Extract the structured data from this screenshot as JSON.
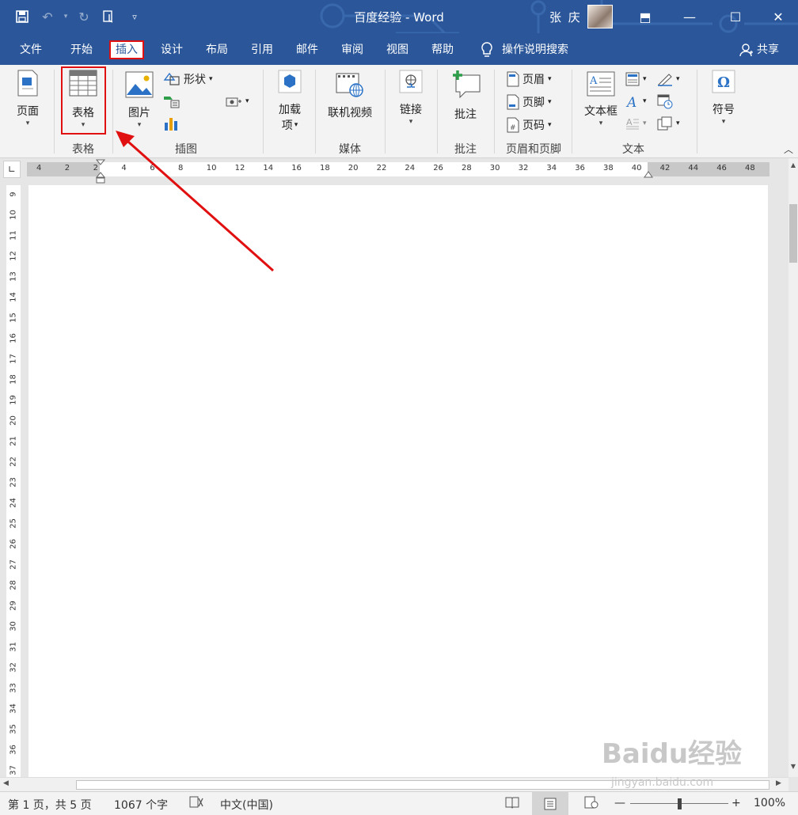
{
  "app": {
    "title": "百度经验  -  Word",
    "user_name": "张 庆"
  },
  "qat": {
    "save_icon": "save-icon",
    "undo_icon": "undo-icon",
    "redo_icon": "redo-icon",
    "touch_icon": "touch-mode-icon",
    "customize_icon": "customize-qat-icon"
  },
  "window_buttons": {
    "ribbon_display": "⬒",
    "minimize": "—",
    "maximize": "☐",
    "close": "✕"
  },
  "tabs": [
    {
      "label": "文件"
    },
    {
      "label": "开始"
    },
    {
      "label": "插入"
    },
    {
      "label": "设计"
    },
    {
      "label": "布局"
    },
    {
      "label": "引用"
    },
    {
      "label": "邮件"
    },
    {
      "label": "审阅"
    },
    {
      "label": "视图"
    },
    {
      "label": "帮助"
    }
  ],
  "tell_me": "操作说明搜索",
  "share": "共享",
  "ribbon": {
    "pages": {
      "label": "页面"
    },
    "table": {
      "label": "表格",
      "group": "表格"
    },
    "picture": {
      "label": "图片"
    },
    "shapes": {
      "label": "形状"
    },
    "illustrations_group": "插图",
    "addins": {
      "label1": "加载",
      "label2": "项"
    },
    "online_video": {
      "label": "联机视频"
    },
    "media_group": "媒体",
    "link": {
      "label": "链接"
    },
    "comment": {
      "label": "批注",
      "group": "批注"
    },
    "header": {
      "label": "页眉"
    },
    "footer": {
      "label": "页脚"
    },
    "page_number": {
      "label": "页码"
    },
    "header_footer_group": "页眉和页脚",
    "textbox": {
      "label": "文本框"
    },
    "text_group": "文本",
    "symbol": {
      "label": "符号"
    }
  },
  "ruler": {
    "h_labels": [
      "4",
      "2",
      "2",
      "4",
      "6",
      "8",
      "10",
      "12",
      "14",
      "16",
      "18",
      "20",
      "22",
      "24",
      "26",
      "28",
      "30",
      "32",
      "34",
      "36",
      "38",
      "40",
      "42",
      "44",
      "46",
      "48"
    ],
    "v_labels": [
      "9",
      "10",
      "11",
      "12",
      "13",
      "14",
      "15",
      "16",
      "17",
      "18",
      "19",
      "20",
      "21",
      "22",
      "23",
      "24",
      "25",
      "26",
      "27",
      "28",
      "29",
      "30",
      "31",
      "32",
      "33",
      "34",
      "35",
      "36",
      "37"
    ]
  },
  "status": {
    "page": "第 1 页，共 5 页",
    "words": "1067 个字",
    "language": "中文(中国)",
    "zoom_minus": "—",
    "zoom_plus": "+",
    "zoom": "100%"
  },
  "watermark": {
    "brand": "Baidu经验",
    "url": "jingyan.baidu.com"
  },
  "colors": {
    "title_bar": "#2b579a",
    "highlight": "#e01010"
  }
}
